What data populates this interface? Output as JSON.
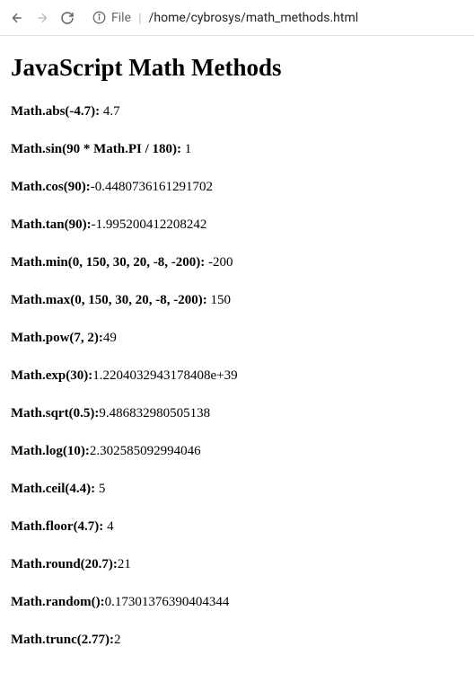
{
  "toolbar": {
    "file_label": "File",
    "url_path": "/home/cybrosys/math_methods.html"
  },
  "page": {
    "heading": "JavaScript Math Methods"
  },
  "methods": [
    {
      "label": "Math.abs(-4.7): ",
      "value": "4.7"
    },
    {
      "label": "Math.sin(90 * Math.PI / 180): ",
      "value": "1"
    },
    {
      "label": "Math.cos(90):",
      "value": "-0.4480736161291702"
    },
    {
      "label": "Math.tan(90):",
      "value": "-1.995200412208242"
    },
    {
      "label": "Math.min(0, 150, 30, 20, -8, -200): ",
      "value": "-200"
    },
    {
      "label": "Math.max(0, 150, 30, 20, -8, -200): ",
      "value": "150"
    },
    {
      "label": "Math.pow(7, 2):",
      "value": "49"
    },
    {
      "label": "Math.exp(30):",
      "value": "1.2204032943178408e+39"
    },
    {
      "label": "Math.sqrt(0.5):",
      "value": "9.486832980505138"
    },
    {
      "label": "Math.log(10):",
      "value": "2.302585092994046"
    },
    {
      "label": "Math.ceil(4.4): ",
      "value": "5"
    },
    {
      "label": "Math.floor(4.7): ",
      "value": "4"
    },
    {
      "label": "Math.round(20.7):",
      "value": "21"
    },
    {
      "label": "Math.random():",
      "value": "0.17301376390404344"
    },
    {
      "label": "Math.trunc(2.77):",
      "value": "2"
    }
  ]
}
